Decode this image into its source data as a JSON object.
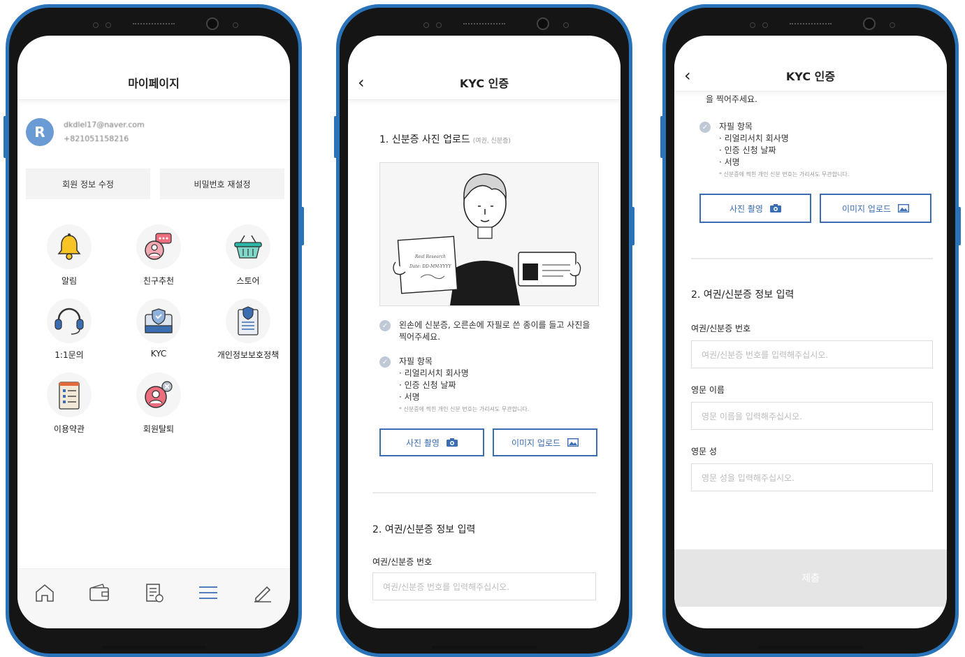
{
  "mypage": {
    "title": "마이페이지",
    "email": "dkdlel17@naver.com",
    "phone": "+821051158216",
    "avatar_letter": "R",
    "edit_info": "회원 정보 수정",
    "reset_password": "비밀번호 재설정",
    "menu": [
      {
        "label": "알림",
        "icon": "bell-icon"
      },
      {
        "label": "친구추천",
        "icon": "friend-referral-icon"
      },
      {
        "label": "스토어",
        "icon": "basket-icon"
      },
      {
        "label": "1:1문의",
        "icon": "headset-icon"
      },
      {
        "label": "KYC",
        "icon": "id-card-shield-icon"
      },
      {
        "label": "개인정보보호정책",
        "icon": "privacy-document-icon"
      },
      {
        "label": "이용약관",
        "icon": "terms-list-icon"
      },
      {
        "label": "회원탈퇴",
        "icon": "user-remove-icon"
      }
    ],
    "tabs": [
      "home-icon",
      "wallet-icon",
      "receipt-icon",
      "menu-icon",
      "pencil-icon"
    ]
  },
  "kyc": {
    "title": "KYC 인증",
    "back_symbol": "‹",
    "section1_title": "1. 신분증 사진 업로드",
    "section1_sub": "(여권, 신분증)",
    "illus_paper_line1": "Real Research",
    "illus_paper_line2": "Date: DD-MM-YYYY",
    "instruction1": "왼손에 신분증, 오른손에 자필로 쓴 종이를 들고 사진을 찍어주세요.",
    "instruction1_tail": "을 찍어주세요.",
    "handwrite_title": "자필 항목",
    "handwrite_items": [
      "· 리얼리서치 회사명",
      "· 인증 신청 날짜",
      "· 서명"
    ],
    "handwrite_note": "* 신분증에 찍힌 개인 신분 번호는 가리셔도 무관합니다.",
    "photo_button": "사진 촬영",
    "upload_button": "이미지 업로드",
    "section2_title": "2. 여권/신분증 정보 입력",
    "id_label": "여권/신분증 번호",
    "id_placeholder": "여권/신분증 번호를 입력해주십시오.",
    "first_name_label": "영문 이름",
    "first_name_placeholder": "영문 이름을 입력해주십시오.",
    "last_name_label": "영문 성",
    "last_name_placeholder": "영문 성을 입력해주십시오.",
    "submit": "제출"
  },
  "colors": {
    "frame": "#2a73b8",
    "accent": "#3b6db3"
  }
}
